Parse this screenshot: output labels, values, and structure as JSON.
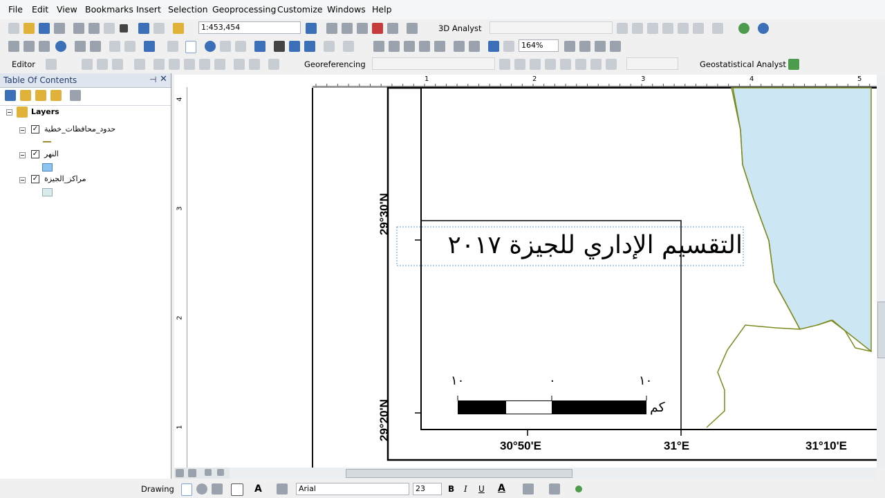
{
  "menu": [
    "File",
    "Edit",
    "View",
    "Bookmarks",
    "Insert",
    "Selection",
    "Geoprocessing",
    "Customize",
    "Windows",
    "Help"
  ],
  "toolbar1": {
    "scale": "1:453,454",
    "analyst3d": "3D Analyst"
  },
  "toolbar2": {
    "zoom": "164%"
  },
  "toolbar3": {
    "editor": "Editor",
    "georef": "Georeferencing",
    "geostat": "Geostatistical Analyst"
  },
  "toc": {
    "title": "Table Of Contents",
    "root": "Layers",
    "layers": [
      {
        "name": "حدود_محافظات_خطية",
        "symbol": "line",
        "color": "#9c8d2e"
      },
      {
        "name": "النهر",
        "symbol": "fill",
        "color": "#8cc3ef"
      },
      {
        "name": "مراكز_الجيزة",
        "symbol": "fill",
        "color": "#d9ecec"
      }
    ]
  },
  "ruler": {
    "h": [
      "1",
      "2",
      "3",
      "4",
      "5"
    ],
    "v": [
      "4",
      "3",
      "2",
      "1"
    ]
  },
  "map": {
    "title": "التقسيم الإداري للجيزة ٢٠١٧",
    "lat_labels": [
      "29°30'N",
      "29°20'N"
    ],
    "lon_labels": [
      "30°50'E",
      "31°E",
      "31°10'E"
    ],
    "scalebar": {
      "left": "١٠",
      "mid": "٠",
      "right": "١٠",
      "unit": "كم"
    },
    "colors": {
      "river": "#cde6f4",
      "boundary": "#7b8a1d"
    }
  },
  "drawbar": {
    "drawing": "Drawing",
    "font": "Arial",
    "size": "23",
    "bold": "B",
    "italic": "I",
    "underline": "U",
    "fontcolor": "A"
  }
}
